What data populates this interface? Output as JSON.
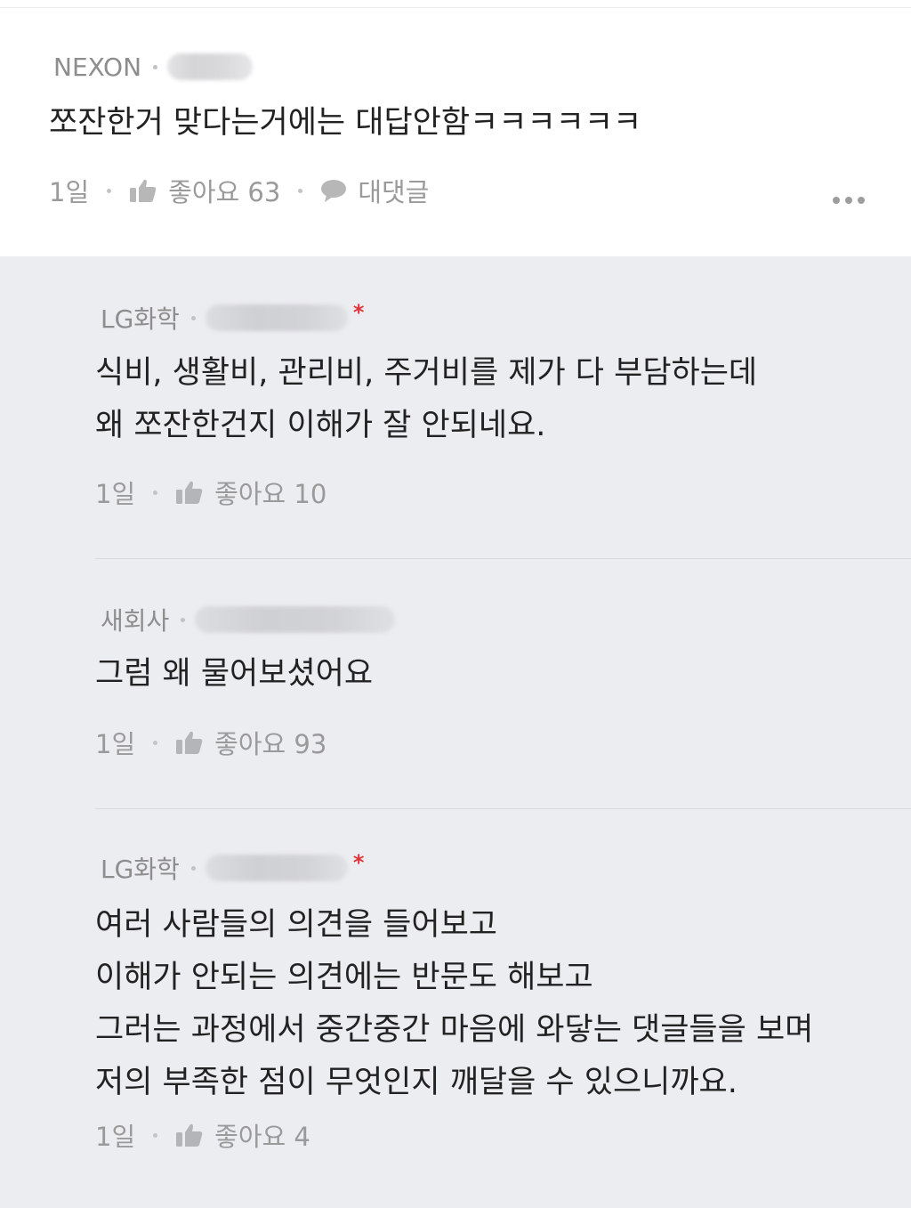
{
  "top_comment": {
    "company": "NEXON",
    "body": [
      "쪼잔한거 맞다는거에는 대답안함ㅋㅋㅋㅋㅋㅋ"
    ],
    "time": "1일",
    "like_label": "좋아요 63",
    "reply_label": "대댓글",
    "more_icon": "more-dots-icon"
  },
  "replies": [
    {
      "company": "LG화학",
      "author_marker": "*",
      "body": [
        "식비, 생활비, 관리비, 주거비를 제가 다 부담하는데",
        "왜 쪼잔한건지 이해가 잘 안되네요."
      ],
      "time": "1일",
      "like_label": "좋아요 10"
    },
    {
      "company": "새회사",
      "author_marker": "",
      "body": [
        "그럼 왜 물어보셨어요"
      ],
      "time": "1일",
      "like_label": "좋아요 93"
    },
    {
      "company": "LG화학",
      "author_marker": "*",
      "body": [
        "여러 사람들의 의견을 들어보고",
        "이해가 안되는 의견에는 반문도 해보고",
        "그러는 과정에서 중간중간 마음에 와닿는 댓글들을 보며",
        "저의 부족한 점이 무엇인지 깨달을 수 있으니까요."
      ],
      "time": "1일",
      "like_label": "좋아요 4"
    }
  ],
  "colors": {
    "reply_background": "#ecedf1",
    "author_marker": "#e1343a",
    "meta_text": "#8a8a8a",
    "body_text": "#222222"
  }
}
